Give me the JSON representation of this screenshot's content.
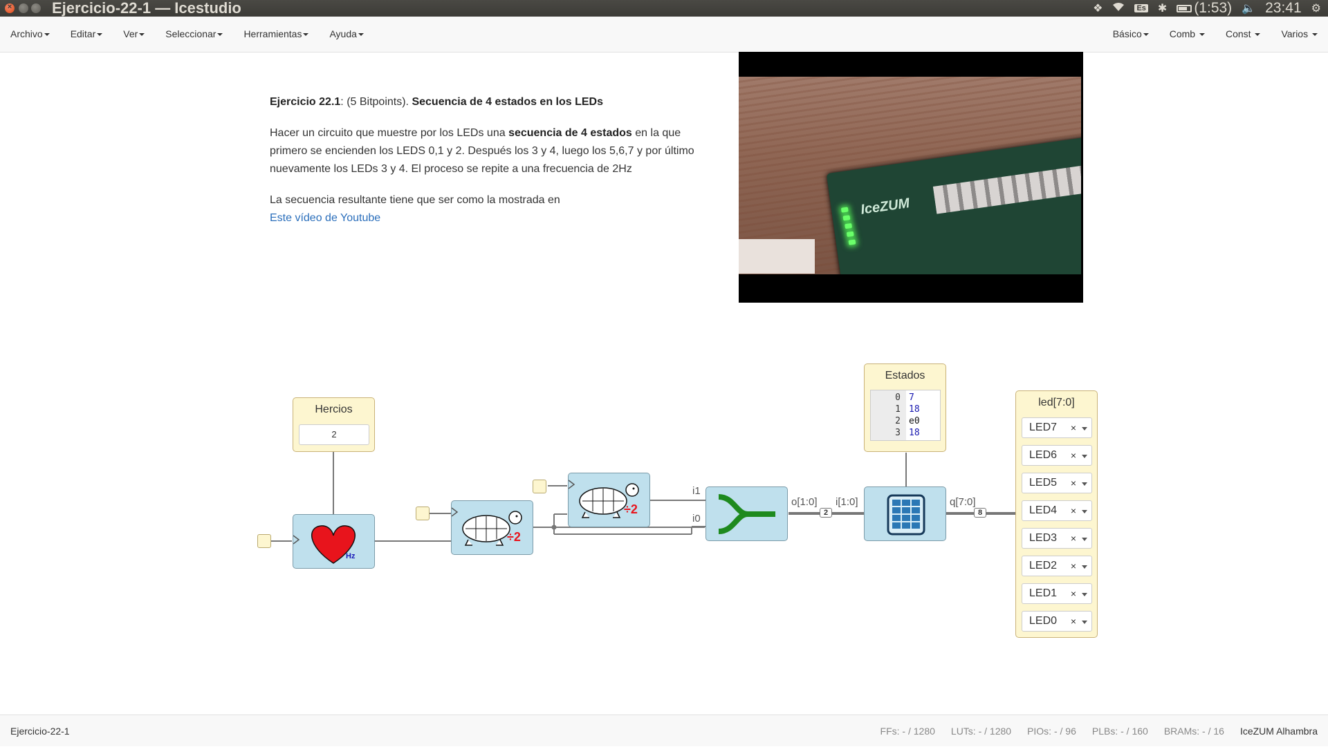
{
  "window": {
    "title": "Ejercicio-22-1 — Icestudio",
    "tray": {
      "keyboard": "Es",
      "battery": "(1:53)",
      "clock": "23:41"
    }
  },
  "menu": {
    "left": [
      "Archivo",
      "Editar",
      "Ver",
      "Seleccionar",
      "Herramientas",
      "Ayuda"
    ],
    "right": [
      "Básico",
      "Comb",
      "Const",
      "Varios"
    ]
  },
  "description": {
    "heading_prefix": "Ejercicio 22.1",
    "heading_points": ": (5 Bitpoints). ",
    "heading_title": "Secuencia de 4 estados en los LEDs",
    "para1_a": "Hacer un circuito que muestre por los LEDs una ",
    "para1_bold": "secuencia de 4 estados",
    "para1_b": " en la que primero se encienden los LEDS 0,1 y 2. Después los 3 y 4, luego los 5,6,7 y por último nuevamente los LEDs 3 y 4. El proceso se repite a una frecuencia de 2Hz",
    "para2": "La secuencia resultante tiene que ser como la mostrada en",
    "link": "Este vídeo de Youtube"
  },
  "video": {
    "board_label": "IceZUM"
  },
  "circuit": {
    "hercios": {
      "title": "Hercios",
      "value": "2"
    },
    "heart": {
      "label": "Hz"
    },
    "divider1": {
      "label": "÷2"
    },
    "divider2": {
      "label": "÷2"
    },
    "join": {
      "in_top": "i1",
      "in_bottom": "i0",
      "out": "o[1:0]",
      "out_width": "2"
    },
    "estados": {
      "title": "Estados",
      "in": "i[1:0]",
      "out": "q[7:0]",
      "out_width": "8",
      "rows": [
        {
          "addr": "0",
          "val": "7"
        },
        {
          "addr": "1",
          "val": "18"
        },
        {
          "addr": "2",
          "val": "e0"
        },
        {
          "addr": "3",
          "val": "18"
        }
      ]
    },
    "leds": {
      "title": "led[7:0]",
      "items": [
        "LED7",
        "LED6",
        "LED5",
        "LED4",
        "LED3",
        "LED2",
        "LED1",
        "LED0"
      ],
      "remove": "×"
    }
  },
  "status": {
    "project": "Ejercicio-22-1",
    "ffs": "FFs:  - / 1280",
    "luts": "LUTs:  - / 1280",
    "pios": "PIOs:  - / 96",
    "plbs": "PLBs:  - / 160",
    "brams": "BRAMs:  - / 16",
    "board": "IceZUM Alhambra"
  },
  "colors": {
    "block": "#bfe0ed",
    "config": "#fdf6d0",
    "link": "#2a6ebb",
    "heart": "#e8141c",
    "join": "#1e8a1e"
  }
}
